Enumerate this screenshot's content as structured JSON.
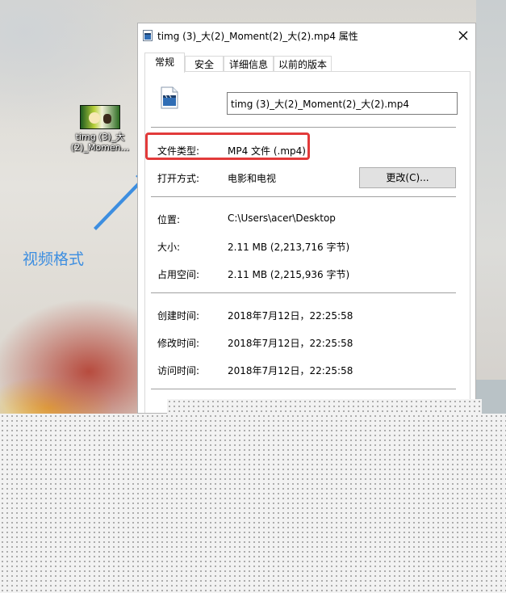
{
  "desktop": {
    "icon_label": "timg (3)_大(2)_Momen..."
  },
  "annotation": {
    "text": "视频格式",
    "highlight_color": "#e23a3a",
    "text_color": "#3d8ee0"
  },
  "dialog": {
    "title": "timg (3)_大(2)_Moment(2)_大(2).mp4 属性",
    "tabs": [
      {
        "label": "常规",
        "active": true
      },
      {
        "label": "安全",
        "active": false
      },
      {
        "label": "详细信息",
        "active": false
      },
      {
        "label": "以前的版本",
        "active": false
      }
    ],
    "file_name": "timg (3)_大(2)_Moment(2)_大(2).mp4",
    "file_type_label": "文件类型:",
    "file_type_value": "MP4 文件 (.mp4)",
    "opens_with_label": "打开方式:",
    "opens_with_value": "电影和电视",
    "change_button": "更改(C)...",
    "location_label": "位置:",
    "location_value": "C:\\Users\\acer\\Desktop",
    "size_label": "大小:",
    "size_value": "2.11 MB (2,213,716 字节)",
    "size_on_disk_label": "占用空间:",
    "size_on_disk_value": "2.11 MB (2,215,936 字节)",
    "created_label": "创建时间:",
    "created_value": "2018年7月12日，22:25:58",
    "modified_label": "修改时间:",
    "modified_value": "2018年7月12日，22:25:58",
    "accessed_label": "访问时间:",
    "accessed_value": "2018年7月12日，22:25:58"
  }
}
